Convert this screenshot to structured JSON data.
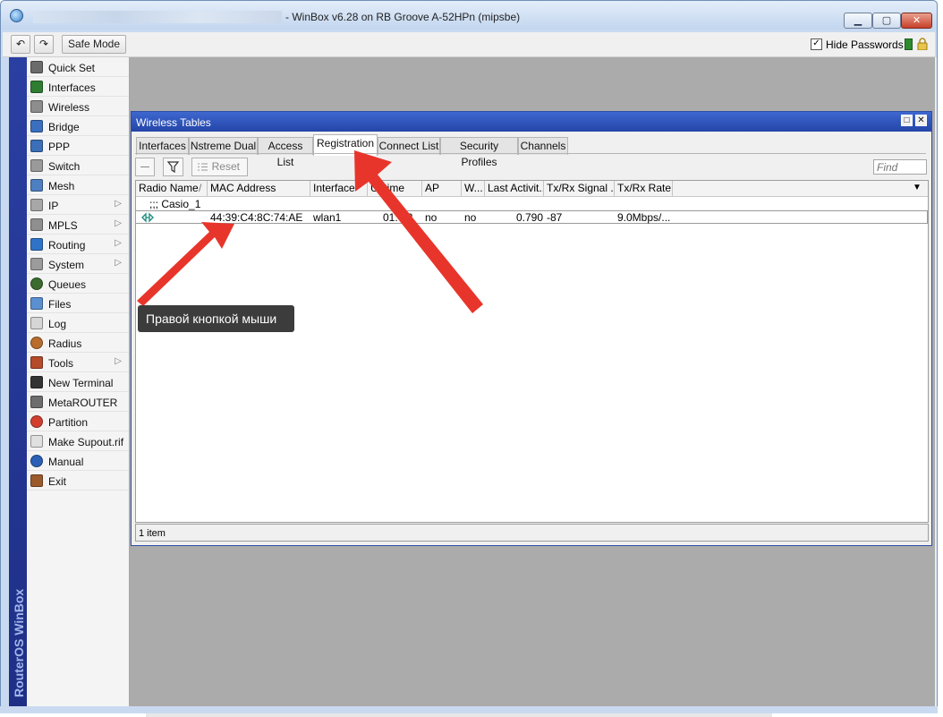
{
  "window": {
    "title": "- WinBox v6.28 on RB Groove A-52HPn (mipsbe)",
    "min_glyph": "▁",
    "max_glyph": "▢",
    "close_glyph": "✕"
  },
  "toolbar": {
    "undo_glyph": "↶",
    "redo_glyph": "↷",
    "safe_mode_label": "Safe Mode",
    "hide_passwords_label": "Hide Passwords",
    "hide_passwords_checked": "✓"
  },
  "brand": {
    "vertical_text": "RouterOS WinBox"
  },
  "menu": {
    "items": [
      {
        "label": "Quick Set",
        "icon": "quick-set-icon",
        "submenu": false
      },
      {
        "label": "Interfaces",
        "icon": "interfaces-icon",
        "submenu": false
      },
      {
        "label": "Wireless",
        "icon": "wireless-icon",
        "submenu": false
      },
      {
        "label": "Bridge",
        "icon": "bridge-icon",
        "submenu": false
      },
      {
        "label": "PPP",
        "icon": "ppp-icon",
        "submenu": false
      },
      {
        "label": "Switch",
        "icon": "switch-icon",
        "submenu": false
      },
      {
        "label": "Mesh",
        "icon": "mesh-icon",
        "submenu": false
      },
      {
        "label": "IP",
        "icon": "ip-icon",
        "submenu": true
      },
      {
        "label": "MPLS",
        "icon": "mpls-icon",
        "submenu": true
      },
      {
        "label": "Routing",
        "icon": "routing-icon",
        "submenu": true
      },
      {
        "label": "System",
        "icon": "system-icon",
        "submenu": true
      },
      {
        "label": "Queues",
        "icon": "queues-icon",
        "submenu": false
      },
      {
        "label": "Files",
        "icon": "files-icon",
        "submenu": false
      },
      {
        "label": "Log",
        "icon": "log-icon",
        "submenu": false
      },
      {
        "label": "Radius",
        "icon": "radius-icon",
        "submenu": false
      },
      {
        "label": "Tools",
        "icon": "tools-icon",
        "submenu": true
      },
      {
        "label": "New Terminal",
        "icon": "terminal-icon",
        "submenu": false
      },
      {
        "label": "MetaROUTER",
        "icon": "metarouter-icon",
        "submenu": false
      },
      {
        "label": "Partition",
        "icon": "partition-icon",
        "submenu": false
      },
      {
        "label": "Make Supout.rif",
        "icon": "supout-icon",
        "submenu": false
      },
      {
        "label": "Manual",
        "icon": "manual-icon",
        "submenu": false
      },
      {
        "label": "Exit",
        "icon": "exit-icon",
        "submenu": false
      }
    ],
    "submenu_glyph": "▷"
  },
  "wireless_tables": {
    "title": "Wireless Tables",
    "tabs": [
      "Interfaces",
      "Nstreme Dual",
      "Access List",
      "Registration",
      "Connect List",
      "Security Profiles",
      "Channels"
    ],
    "active_tab": "Registration",
    "reset_label": "Reset",
    "find_placeholder": "Find",
    "columns": [
      "Radio Name",
      "/",
      "MAC Address",
      "Interface",
      "Uptime",
      "AP",
      "W...",
      "Last Activit...",
      "Tx/Rx Signal ...",
      "Tx/Rx Rate"
    ],
    "comment_row": ";;; Casio_1",
    "row": {
      "mac": "44:39:C4:8C:74:AE",
      "interface": "wlan1",
      "uptime": "01:   52",
      "ap": "no",
      "wds": "no",
      "last_activity": "0.790",
      "signal": "-87",
      "rate": "9.0Mbps/..."
    },
    "status": "1 item"
  },
  "annotation": {
    "tooltip": "Правой кнопкой мыши",
    "arrow_color": "#e8352b"
  }
}
